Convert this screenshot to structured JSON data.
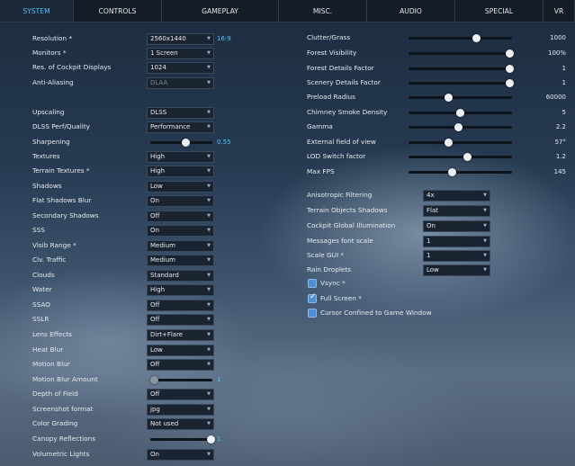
{
  "tabs": [
    "SYSTEM",
    "CONTROLS",
    "GAMEPLAY",
    "MISC.",
    "AUDIO",
    "SPECIAL",
    "VR"
  ],
  "active_tab": "SYSTEM",
  "left_settings": [
    {
      "label": "Resolution *",
      "kind": "dropdown",
      "value": "2560x1440",
      "extra": "16:9"
    },
    {
      "label": "Monitors *",
      "kind": "dropdown",
      "value": "1 Screen"
    },
    {
      "label": "Res. of Cockpit Displays",
      "kind": "dropdown",
      "value": "1024"
    },
    {
      "label": "Anti-Aliasing",
      "kind": "dropdown",
      "value": "DLAA",
      "disabled": true
    },
    {
      "label": "Upscaling",
      "kind": "dropdown",
      "value": "DLSS"
    },
    {
      "label": "DLSS Perf/Quality",
      "kind": "dropdown",
      "value": "Performance"
    },
    {
      "label": "Sharpening",
      "kind": "slider",
      "value": "0.55",
      "fraction": 0.55
    },
    {
      "label": "Textures",
      "kind": "dropdown",
      "value": "High"
    },
    {
      "label": "Terrain Textures *",
      "kind": "dropdown",
      "value": "High"
    },
    {
      "label": "Shadows",
      "kind": "dropdown",
      "value": "Low"
    },
    {
      "label": "Flat Shadows Blur",
      "kind": "dropdown",
      "value": "On"
    },
    {
      "label": "Secondary Shadows",
      "kind": "dropdown",
      "value": "Off"
    },
    {
      "label": "SSS",
      "kind": "dropdown",
      "value": "On"
    },
    {
      "label": "Visib Range *",
      "kind": "dropdown",
      "value": "Medium"
    },
    {
      "label": "Civ. Traffic",
      "kind": "dropdown",
      "value": "Medium"
    },
    {
      "label": "Clouds",
      "kind": "dropdown",
      "value": "Standard"
    },
    {
      "label": "Water",
      "kind": "dropdown",
      "value": "High"
    },
    {
      "label": "SSAO",
      "kind": "dropdown",
      "value": "Off"
    },
    {
      "label": "SSLR",
      "kind": "dropdown",
      "value": "Off"
    },
    {
      "label": "Lens Effects",
      "kind": "dropdown",
      "value": "Dirt+Flare"
    },
    {
      "label": "Heat Blur",
      "kind": "dropdown",
      "value": "Low"
    },
    {
      "label": "Motion Blur",
      "kind": "dropdown",
      "value": "Off"
    },
    {
      "label": "Motion Blur Amount",
      "kind": "slider",
      "value": "1",
      "fraction": 0.0,
      "disabled": true
    },
    {
      "label": "Depth of Field",
      "kind": "dropdown",
      "value": "Off"
    },
    {
      "label": "Screenshot format",
      "kind": "dropdown",
      "value": "jpg"
    },
    {
      "label": "Color Grading",
      "kind": "dropdown",
      "value": "Not used"
    },
    {
      "label": "Canopy Reflections",
      "kind": "slider",
      "value": "1",
      "fraction": 1.0
    },
    {
      "label": "Volumetric Lights",
      "kind": "dropdown",
      "value": "On"
    }
  ],
  "right_sliders": [
    {
      "label": "Clutter/Grass",
      "value": "1000",
      "fraction": 0.66
    },
    {
      "label": "Forest Visibility",
      "value": "100%",
      "fraction": 1.0
    },
    {
      "label": "Forest Details Factor",
      "value": "1",
      "fraction": 1.0
    },
    {
      "label": "Scenery Details Factor",
      "value": "1",
      "fraction": 1.0
    },
    {
      "label": "Preload Radius",
      "value": "60000",
      "fraction": 0.38
    },
    {
      "label": "Chimney Smoke Density",
      "value": "5",
      "fraction": 0.5
    },
    {
      "label": "Gamma",
      "value": "2.2",
      "fraction": 0.48
    },
    {
      "label": "External field of view",
      "value": "57°",
      "fraction": 0.38
    },
    {
      "label": "LOD Switch factor",
      "value": "1.2",
      "fraction": 0.57
    },
    {
      "label": "Max FPS",
      "value": "145",
      "fraction": 0.42
    }
  ],
  "right_dropdowns": [
    {
      "label": "Anisotropic Filtering",
      "value": "4x"
    },
    {
      "label": "Terrain Objects Shadows",
      "value": "Flat"
    },
    {
      "label": "Cockpit Global Illumination",
      "value": "On"
    },
    {
      "label": "Messages font scale",
      "value": "1"
    },
    {
      "label": "Scale GUI *",
      "value": "1"
    },
    {
      "label": "Rain Droplets",
      "value": "Low"
    }
  ],
  "checkboxes": [
    {
      "label": "Vsync *",
      "checked": false
    },
    {
      "label": "Full Screen *",
      "checked": true
    },
    {
      "label": "Cursor Confined to Game Window",
      "checked": false
    }
  ]
}
